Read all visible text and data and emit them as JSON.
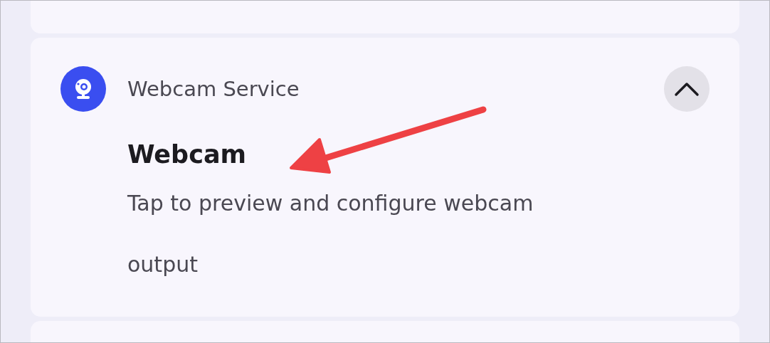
{
  "card": {
    "service": "Webcam Service",
    "expanded": true,
    "title": "Webcam",
    "description": "Tap to preview and configure webcam output"
  },
  "annotation": {
    "kind": "arrow"
  }
}
